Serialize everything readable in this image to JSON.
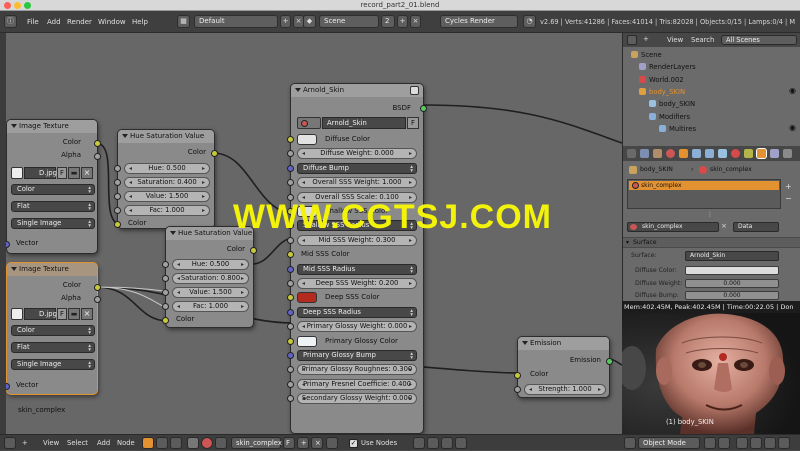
{
  "window": {
    "title": "record_part2_01.blend"
  },
  "topbar": {
    "menus": [
      "File",
      "Add",
      "Render",
      "Window",
      "Help"
    ],
    "layout": "Default",
    "scene": "Scene",
    "scene_users": "2",
    "engine": "Cycles Render",
    "stats": "v2.69 | Verts:41286 | Faces:41014 | Tris:82028 | Objects:0/15 | Lamps:0/4 | M"
  },
  "watermark": "WWW.CGTSJ.COM",
  "nodes": {
    "image_texture_1": {
      "title": "Image Texture",
      "out_color": "Color",
      "out_alpha": "Alpha",
      "image": "D.jpg",
      "f": "F",
      "color": "Color",
      "projection": "Flat",
      "source": "Single Image",
      "in_vector": "Vector"
    },
    "hue_sat_1": {
      "title": "Hue Saturation Value",
      "out_color": "Color",
      "hue": "Hue: 0.500",
      "saturation": "Saturation: 0.400",
      "value": "Value: 1.500",
      "fac": "Fac: 1.000",
      "in_color": "Color"
    },
    "image_texture_2": {
      "title": "Image Texture",
      "out_color": "Color",
      "out_alpha": "Alpha",
      "image": "D.jpg",
      "f": "F",
      "color": "Color",
      "projection": "Flat",
      "source": "Single Image",
      "in_vector": "Vector"
    },
    "hue_sat_2": {
      "title": "Hue Saturation Value",
      "out_color": "Color",
      "hue": "Hue: 0.500",
      "saturation": "Saturation: 0.800",
      "value": "Value: 1.500",
      "fac": "Fac: 1.000",
      "in_color": "Color"
    },
    "arnold": {
      "title": "Arnold_Skin",
      "out_bsdf": "BSDF",
      "material": "Arnold_Skin",
      "f": "F",
      "rows": [
        {
          "kind": "color",
          "label": "Diffuse Color",
          "swatch": "#e2e2e2"
        },
        {
          "kind": "slider",
          "label": "Diffuse Weight: 0.000"
        },
        {
          "kind": "drop",
          "label": "Diffuse Bump"
        },
        {
          "kind": "slider",
          "label": "Overall SSS Weight: 1.000"
        },
        {
          "kind": "slider",
          "label": "Overall SSS Scale: 0.100"
        },
        {
          "kind": "color",
          "label": "Shallow SSS Color",
          "swatch": "#e2e2e2"
        },
        {
          "kind": "drop",
          "label": "Shallow SSS Radius"
        },
        {
          "kind": "slider",
          "label": "Mid SSS Weight: 0.300"
        },
        {
          "kind": "text",
          "label": "Mid SSS Color"
        },
        {
          "kind": "drop",
          "label": "Mid SSS Radius"
        },
        {
          "kind": "slider",
          "label": "Deep SSS Weight: 0.200"
        },
        {
          "kind": "color",
          "label": "Deep SSS Color",
          "swatch": "#b32a1e"
        },
        {
          "kind": "drop",
          "label": "Deep SSS Radius"
        },
        {
          "kind": "slider",
          "label": "Primary Glossy Weight: 0.000"
        },
        {
          "kind": "color",
          "label": "Primary Glossy Color",
          "swatch": "#eef2f6"
        },
        {
          "kind": "drop",
          "label": "Primary Glossy Bump"
        },
        {
          "kind": "slider",
          "label": "Primary Glossy Roughnes: 0.300"
        },
        {
          "kind": "slider",
          "label": "Primary Fresnel Coefficie: 0.400"
        },
        {
          "kind": "slider",
          "label": "Secondary Glossy Weight: 0.000"
        }
      ]
    },
    "emission": {
      "title": "Emission",
      "out_emission": "Emission",
      "in_color": "Color",
      "strength": "Strength: 1.000"
    }
  },
  "editor": {
    "material_label": "skin_complex"
  },
  "outliner": {
    "menus": [
      "View",
      "Search"
    ],
    "filter": "All Scenes",
    "items": [
      {
        "label": "Scene",
        "icon": "scene-icon",
        "color": "#c9a25b"
      },
      {
        "label": "RenderLayers",
        "icon": "render-layers-icon",
        "color": "#a0a0c8"
      },
      {
        "label": "World.002",
        "icon": "world-icon",
        "color": "#d64a4a"
      },
      {
        "label": "body_SKIN",
        "icon": "mesh-object-icon",
        "color": "#e0a040"
      },
      {
        "label": "body_SKIN",
        "icon": "mesh-data-icon",
        "color": "#9ac0e0"
      },
      {
        "label": "Modifiers",
        "icon": "wrench-icon",
        "color": "#8ab0d8"
      },
      {
        "label": "Multires",
        "icon": "modifier-icon",
        "color": "#8ab0d8"
      }
    ]
  },
  "properties": {
    "breadcrumb": [
      "body_SKIN",
      "skin_complex"
    ],
    "slot": "skin_complex",
    "material": "skin_complex",
    "data_mode": "Data",
    "section": "Surface",
    "surface_label": "Surface:",
    "surface_value": "Arnold_Skin",
    "diffuse_color_label": "Diffuse Color:",
    "diffuse_weight_label": "Diffuse Weight:",
    "diffuse_weight": "0.000",
    "diffuse_bump_label": "Diffuse Bump:",
    "diffuse_bump": "0.000"
  },
  "render": {
    "stats": "Mem:402.45M, Peak:402.45M | Time:00:22.05 | Don",
    "caption": "(1) body_SKIN"
  },
  "bottombar": {
    "menus": [
      "View",
      "Select",
      "Add",
      "Node"
    ],
    "material": "skin_complex",
    "use_nodes": "Use Nodes",
    "mode": "Object Mode"
  },
  "colors": {
    "accent": "#e39232",
    "socket_yellow": "#c8c83d",
    "socket_blue": "#6262c7",
    "socket_green": "#59c95f",
    "watermark": "#f2f20a"
  }
}
